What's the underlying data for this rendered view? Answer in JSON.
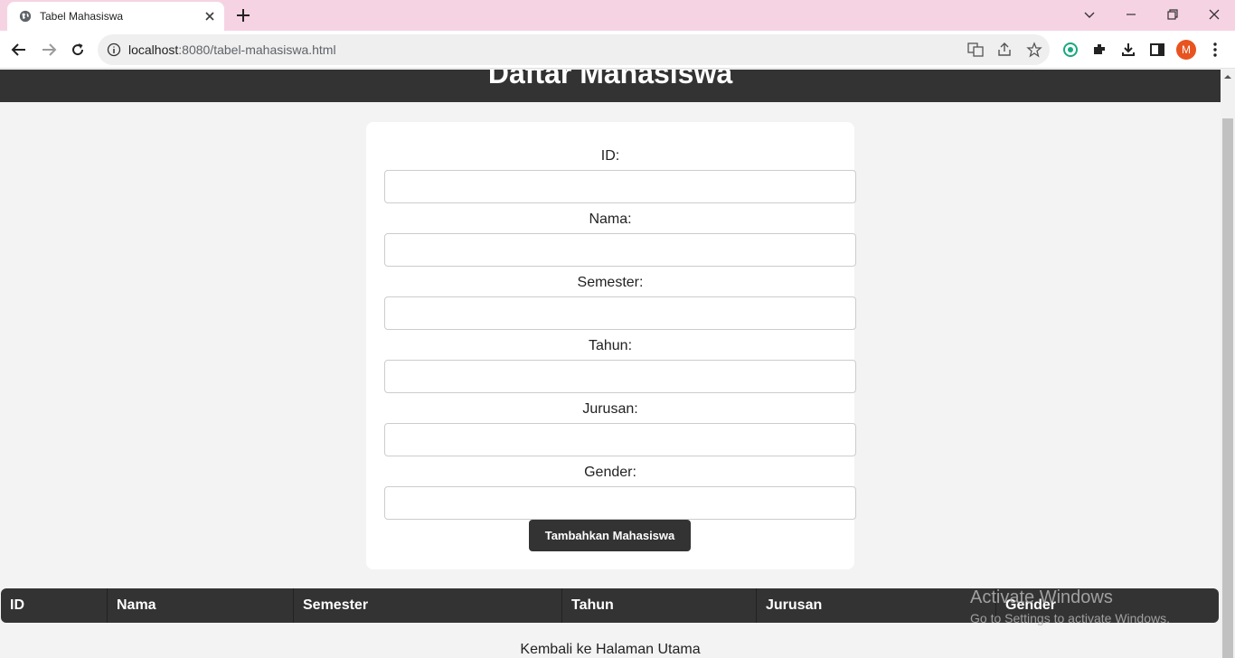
{
  "browser": {
    "tab_title": "Tabel Mahasiswa",
    "url_host": "localhost",
    "url_rest": ":8080/tabel-mahasiswa.html",
    "avatar_letter": "M"
  },
  "page": {
    "title": "Daftar Mahasiswa",
    "form": {
      "fields": [
        {
          "label": "ID:",
          "value": ""
        },
        {
          "label": "Nama:",
          "value": ""
        },
        {
          "label": "Semester:",
          "value": ""
        },
        {
          "label": "Tahun:",
          "value": ""
        },
        {
          "label": "Jurusan:",
          "value": ""
        },
        {
          "label": "Gender:",
          "value": ""
        }
      ],
      "submit_label": "Tambahkan Mahasiswa"
    },
    "table": {
      "columns": [
        "ID",
        "Nama",
        "Semester",
        "Tahun",
        "Jurusan",
        "Gender"
      ]
    },
    "back_link": "Kembali ke Halaman Utama"
  },
  "watermark": {
    "line1": "Activate Windows",
    "line2": "Go to Settings to activate Windows."
  },
  "colors": {
    "tabbar": "#f6d3e3",
    "header": "#333333",
    "page_bg": "#f3f3f3",
    "avatar": "#e8531f"
  }
}
